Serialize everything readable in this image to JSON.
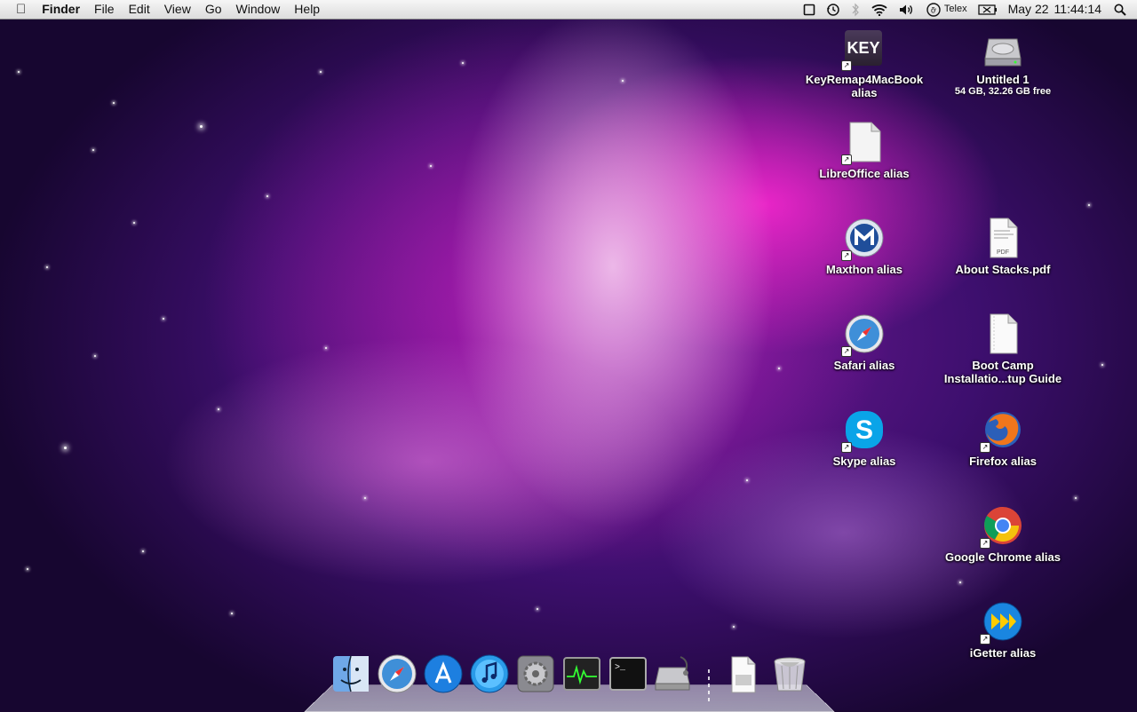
{
  "menubar": {
    "app_name": "Finder",
    "menus": [
      "File",
      "Edit",
      "View",
      "Go",
      "Window",
      "Help"
    ],
    "status": {
      "input_source": "Telex",
      "date": "May 22",
      "time": "11:44:14"
    }
  },
  "desktop": {
    "icons": [
      {
        "label": "KeyRemap4MacBook",
        "label2": "alias",
        "icon": "keyremap-icon"
      },
      {
        "label": "Untitled 1",
        "sub": "54 GB, 32.26 GB free",
        "icon": "hard-drive-icon"
      },
      {
        "label": "LibreOffice alias",
        "icon": "libreoffice-icon"
      },
      {
        "label": "Maxthon alias",
        "icon": "maxthon-icon"
      },
      {
        "label": "About Stacks.pdf",
        "icon": "pdf-document-icon"
      },
      {
        "label": "Safari alias",
        "icon": "safari-icon"
      },
      {
        "label": "Boot Camp",
        "label2": "Installatio...tup Guide",
        "icon": "document-icon"
      },
      {
        "label": "Skype alias",
        "icon": "skype-icon"
      },
      {
        "label": "Firefox alias",
        "icon": "firefox-icon"
      },
      {
        "label": "Google Chrome alias",
        "icon": "chrome-icon"
      },
      {
        "label": "iGetter alias",
        "icon": "igetter-icon"
      }
    ],
    "key_badge": "KEY"
  },
  "dock": {
    "items": [
      "finder-icon",
      "safari-icon",
      "app-store-icon",
      "itunes-icon",
      "system-preferences-icon",
      "activity-monitor-icon",
      "terminal-icon",
      "disk-utility-icon",
      "downloads-stack-icon",
      "trash-icon"
    ],
    "terminal_prompt": ">_"
  }
}
